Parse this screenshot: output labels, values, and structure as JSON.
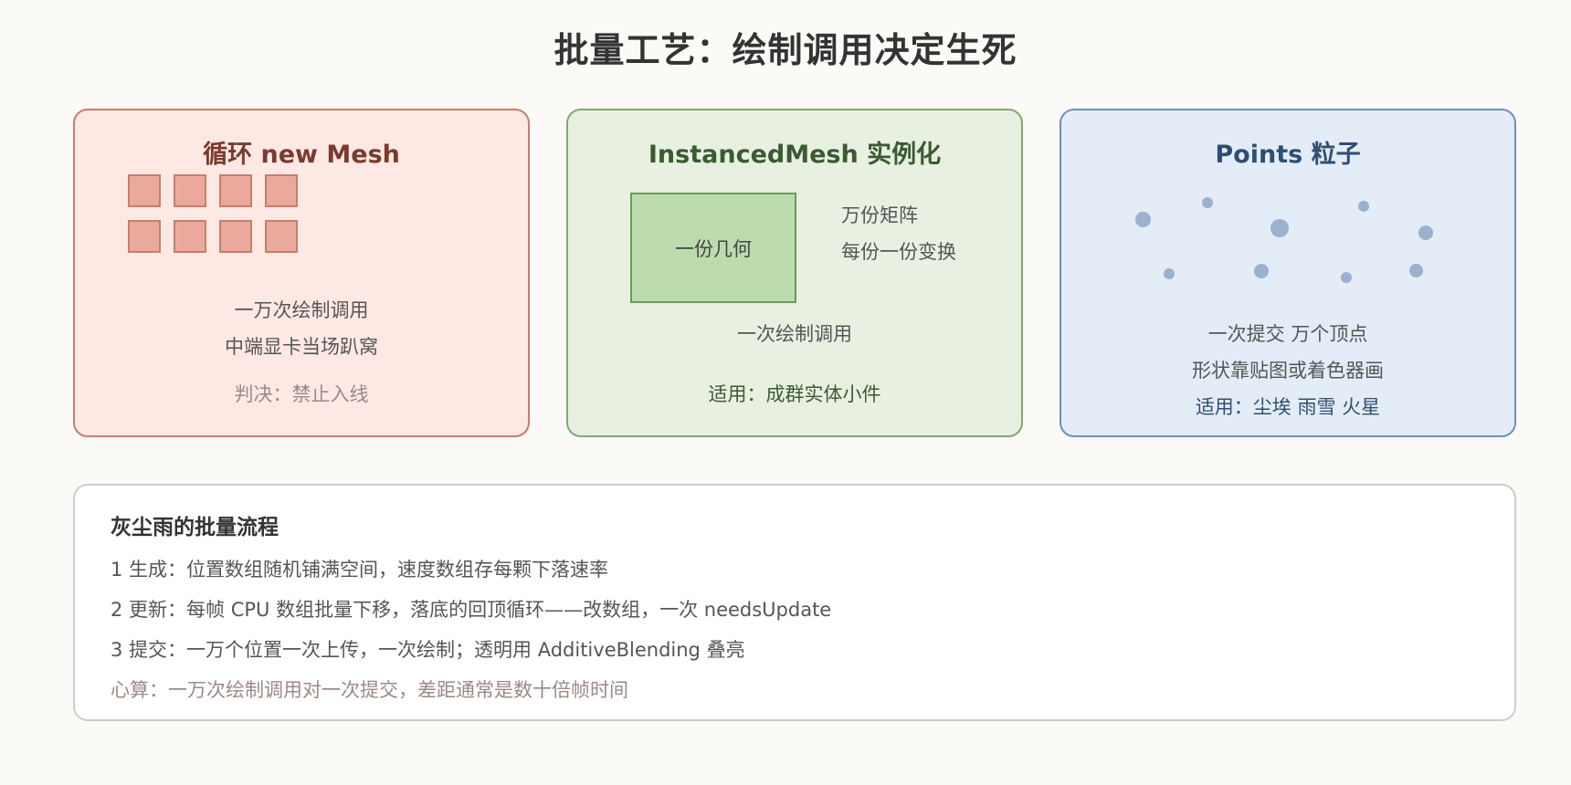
{
  "title": "批量工艺：绘制调用决定生死",
  "cards": {
    "loop": {
      "title": "循环 new Mesh",
      "line1": "一万次绘制调用",
      "line2": "中端显卡当场趴窝",
      "verdict": "判决：禁止入线"
    },
    "instanced": {
      "title": "InstancedMesh 实例化",
      "geometry_label": "一份几何",
      "note1": "万份矩阵",
      "note2": "每份一份变换",
      "line1": "一次绘制调用",
      "use": "适用：成群实体小件"
    },
    "points": {
      "title": "Points 粒子",
      "line1": "一次提交 万个顶点",
      "line2": "形状靠贴图或着色器画",
      "use": "适用：尘埃 雨雪 火星"
    }
  },
  "flow": {
    "title": "灰尘雨的批量流程",
    "steps": [
      "1 生成：位置数组随机铺满空间，速度数组存每颗下落速率",
      "2 更新：每帧 CPU 数组批量下移，落底的回顶循环——改数组，一次 needsUpdate",
      "3 提交：一万个位置一次上传，一次绘制；透明用 AdditiveBlending 叠亮"
    ],
    "note": "心算：一万次绘制调用对一次提交，差距通常是数十倍帧时间"
  },
  "colors": {
    "red_fill": "#fde8e4",
    "red_border": "#c87c6e",
    "green_fill": "#e8f0e2",
    "green_border": "#82a872",
    "blue_fill": "#e4ecf7",
    "blue_border": "#6f90b6"
  }
}
